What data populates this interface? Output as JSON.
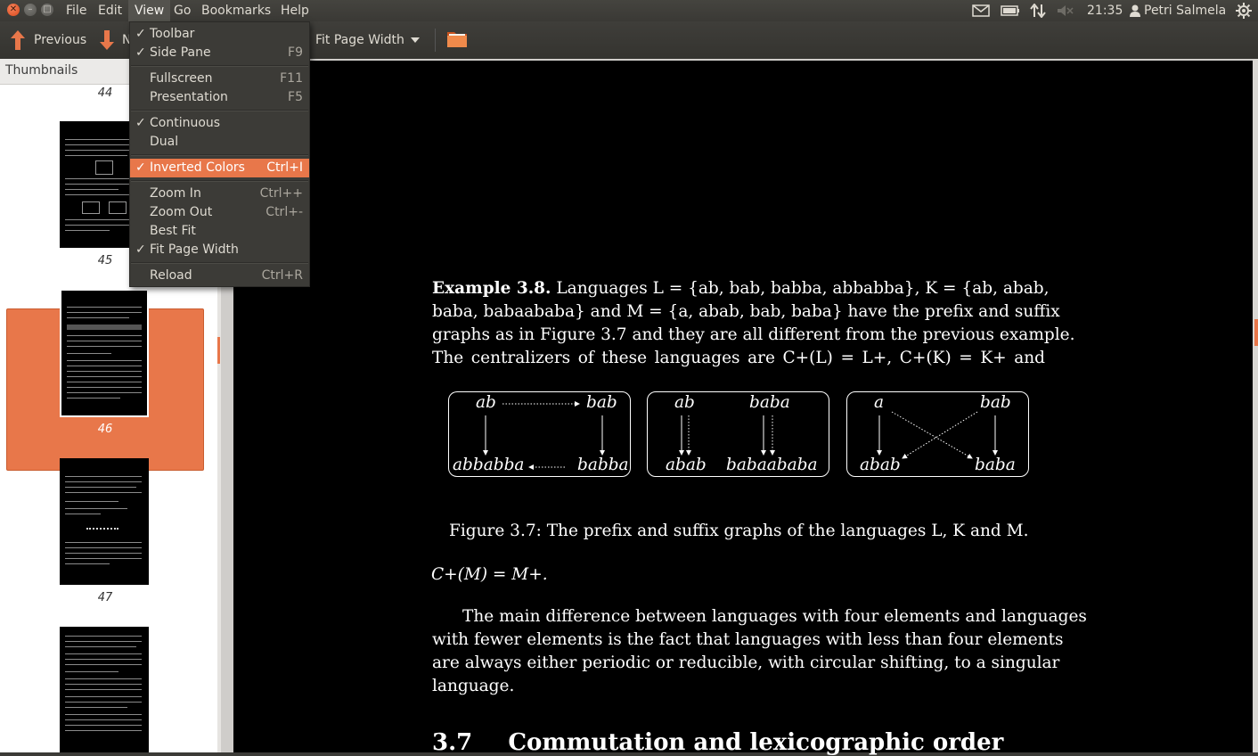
{
  "topbar": {
    "menus": [
      "File",
      "Edit",
      "View",
      "Go",
      "Bookmarks",
      "Help"
    ],
    "clock": "21:35",
    "user": "Petri Salmela"
  },
  "toolbar": {
    "previous": "Previous",
    "next_partial": "N",
    "zoom": "Fit Page Width"
  },
  "sidepane": {
    "title": "Thumbnails",
    "pages": [
      "44",
      "45",
      "46",
      "47"
    ],
    "selected_page": "46"
  },
  "view_menu": {
    "items": [
      {
        "label": "Toolbar",
        "accel": "",
        "checked": true
      },
      {
        "label": "Side Pane",
        "accel": "F9",
        "checked": true
      },
      {
        "label": "Fullscreen",
        "accel": "F11",
        "checked": false
      },
      {
        "label": "Presentation",
        "accel": "F5",
        "checked": false
      },
      {
        "label": "Continuous",
        "accel": "",
        "checked": true
      },
      {
        "label": "Dual",
        "accel": "",
        "checked": false
      },
      {
        "label": "Inverted Colors",
        "accel": "Ctrl+I",
        "checked": true
      },
      {
        "label": "Zoom In",
        "accel": "Ctrl++",
        "checked": false
      },
      {
        "label": "Zoom Out",
        "accel": "Ctrl+-",
        "checked": false
      },
      {
        "label": "Best Fit",
        "accel": "",
        "checked": false
      },
      {
        "label": "Fit Page Width",
        "accel": "",
        "checked": true
      },
      {
        "label": "Reload",
        "accel": "Ctrl+R",
        "checked": false
      }
    ],
    "highlighted": "Inverted Colors"
  },
  "document": {
    "example_heading": "Example 3.8.",
    "para1": [
      "Languages L = {ab, bab, babba, abbabba}, K = {ab, abab,",
      "baba, babaababa} and M = {a, abab, bab, baba} have the prefix and suffix",
      "graphs as in Figure 3.7 and they are all different from the previous example.",
      "The centralizers of these languages are C+(L) = L+, C+(K) = K+ and"
    ],
    "graphs": [
      {
        "top_left": "ab",
        "top_right": "bab",
        "bottom_left": "abbabba",
        "bottom_right": "babba"
      },
      {
        "top_left": "ab",
        "top_right": "baba",
        "bottom_left": "abab",
        "bottom_right": "babaababa"
      },
      {
        "top_left": "a",
        "top_right": "bab",
        "bottom_left": "abab",
        "bottom_right": "baba"
      }
    ],
    "caption": "Figure 3.7: The prefix and suffix graphs of the languages L, K and M.",
    "cm_line": "C+(M) = M+.",
    "para2": [
      "The main difference between languages with four elements and languages",
      "with fewer elements is the fact that languages with less than four elements",
      "are always either periodic or reducible, with circular shifting, to a singular",
      "language."
    ],
    "section_number": "3.7",
    "section_title": "Commutation and lexicographic order"
  },
  "colors": {
    "accent": "#e8774a",
    "panel": "#3c3b37",
    "page_bg": "#000000",
    "page_text": "#ffffff"
  }
}
